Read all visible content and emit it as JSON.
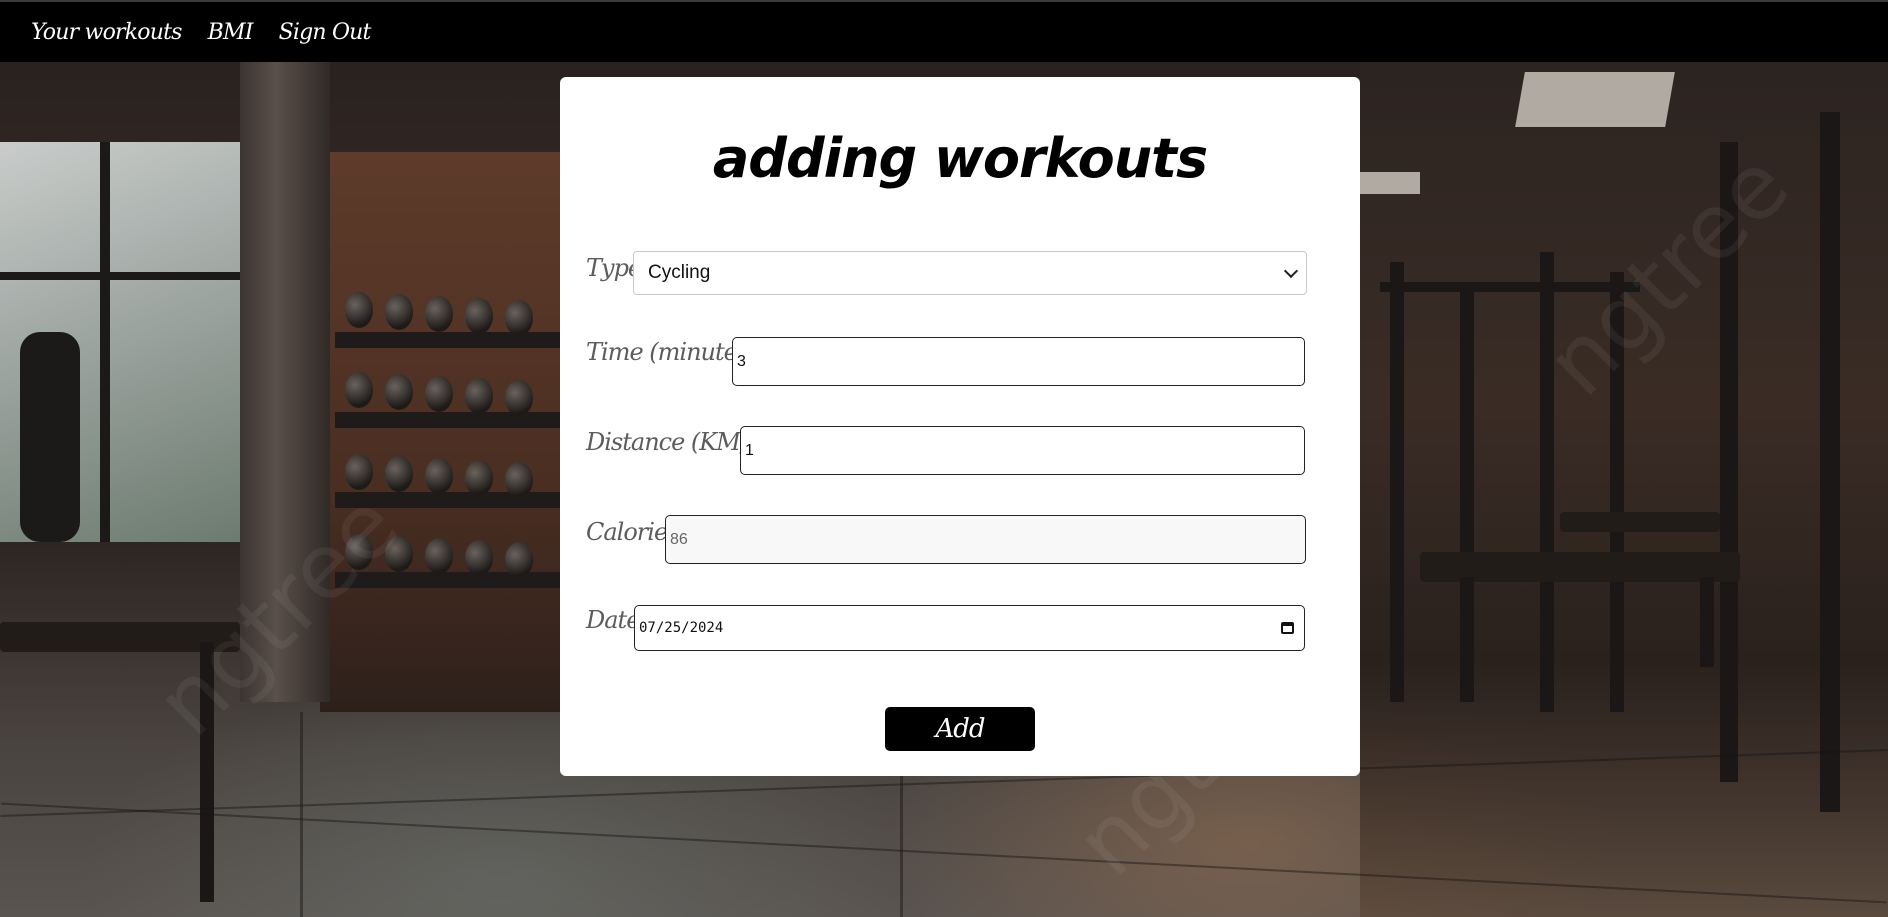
{
  "nav": {
    "items": [
      {
        "label": "Your workouts"
      },
      {
        "label": "BMI"
      },
      {
        "label": "Sign Out"
      }
    ]
  },
  "form": {
    "title": "adding workouts",
    "type": {
      "label": "Type",
      "value": "Cycling"
    },
    "time": {
      "label": "Time (minutes)",
      "value": "3"
    },
    "distance": {
      "label": "Distance (KM)",
      "value": "1"
    },
    "calories": {
      "label": "Calories",
      "value": "86"
    },
    "date": {
      "label": "Date",
      "value": "07/25/2024"
    },
    "submit_label": "Add"
  }
}
